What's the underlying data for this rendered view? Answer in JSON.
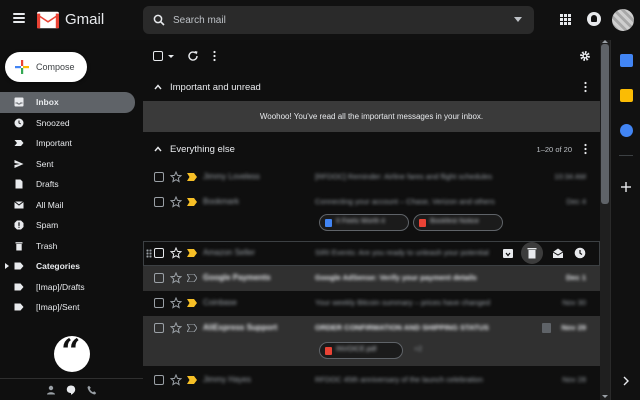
{
  "app": {
    "name": "Gmail",
    "search_placeholder": "Search mail"
  },
  "compose": {
    "label": "Compose"
  },
  "sidebar": {
    "items": [
      {
        "label": "Inbox",
        "icon": "inbox-icon",
        "active": true
      },
      {
        "label": "Snoozed",
        "icon": "clock-icon"
      },
      {
        "label": "Important",
        "icon": "important-icon"
      },
      {
        "label": "Sent",
        "icon": "send-icon"
      },
      {
        "label": "Drafts",
        "icon": "draft-icon"
      },
      {
        "label": "All Mail",
        "icon": "all-mail-icon"
      },
      {
        "label": "Spam",
        "icon": "spam-icon"
      },
      {
        "label": "Trash",
        "icon": "trash-icon"
      },
      {
        "label": "Categories",
        "icon": "label-icon",
        "bold": true
      },
      {
        "label": "[Imap]/Drafts",
        "icon": "label-icon"
      },
      {
        "label": "[Imap]/Sent",
        "icon": "label-icon"
      }
    ]
  },
  "sections": {
    "important": {
      "title": "Important and unread",
      "empty_message": "Woohoo! You've read all the important messages in your inbox."
    },
    "everything": {
      "title": "Everything else",
      "count": "1–20 of 20"
    }
  },
  "emails": [
    {
      "sender": "Jimmy Loveless",
      "subject": "[RFDOC] Reminder: Airline fares and flight schedules",
      "date": "10:34 AM",
      "unread": false,
      "important": true
    },
    {
      "sender": "Bookmark",
      "subject": "Connecting your account – Chase, Verizon and others",
      "date": "Dec 4",
      "unread": false,
      "important": true,
      "attachments": [
        "It Feels Worth it",
        "Bookfest Notice"
      ]
    },
    {
      "sender": "Amazon Seller",
      "subject": "SIRI Events: Are you ready to unleash your potential",
      "date": "Dec 3",
      "unread": false,
      "important": true,
      "hovered": true
    },
    {
      "sender": "Google Payments",
      "subject": "Google AdSense: Verify your payment details",
      "date": "Dec 1",
      "unread": true,
      "important": false
    },
    {
      "sender": "Coinbase",
      "subject": "Your weekly Bitcoin summary – prices have changed",
      "date": "Nov 30",
      "unread": false,
      "important": true
    },
    {
      "sender": "AliExpress Support",
      "subject": "ORDER CONFIRMATION AND SHIPPING STATUS",
      "date": "Nov 29",
      "unread": true,
      "important": false,
      "attachments": [
        "INVOICE.pdf"
      ],
      "more_attachments": "+2"
    },
    {
      "sender": "Jimmy Hayes",
      "subject": "RFDOC 45th anniversary of the launch celebration",
      "date": "Nov 28",
      "unread": false,
      "important": true
    }
  ],
  "colors": {
    "important_marker": "#f6bf26",
    "accent_blue": "#4285f4",
    "attachment_red": "#ea4335",
    "attachment_blue": "#4285f4"
  }
}
